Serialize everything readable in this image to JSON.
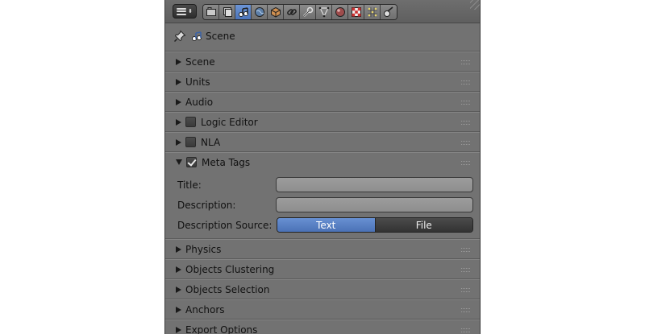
{
  "header": {
    "tabs": [
      {
        "name": "render"
      },
      {
        "name": "render-layers"
      },
      {
        "name": "scene",
        "active": true
      },
      {
        "name": "world"
      },
      {
        "name": "object"
      },
      {
        "name": "constraints"
      },
      {
        "name": "modifiers"
      },
      {
        "name": "data"
      },
      {
        "name": "material"
      },
      {
        "name": "texture"
      },
      {
        "name": "particles"
      },
      {
        "name": "physics"
      }
    ]
  },
  "context": {
    "label": "Scene"
  },
  "panels": {
    "scene": {
      "label": "Scene"
    },
    "units": {
      "label": "Units"
    },
    "audio": {
      "label": "Audio"
    },
    "logic_editor": {
      "label": "Logic Editor",
      "checked": false
    },
    "nla": {
      "label": "NLA",
      "checked": false
    },
    "meta_tags": {
      "label": "Meta Tags",
      "checked": true,
      "expanded": true,
      "title_label": "Title:",
      "title_value": "",
      "description_label": "Description:",
      "description_value": "",
      "source_label": "Description Source:",
      "source_options": [
        "Text",
        "File"
      ],
      "source_selected": "Text"
    },
    "physics": {
      "label": "Physics"
    },
    "objects_clustering": {
      "label": "Objects Clustering"
    },
    "objects_selection": {
      "label": "Objects Selection"
    },
    "anchors": {
      "label": "Anchors"
    },
    "export_options": {
      "label": "Export Options"
    }
  },
  "colors": {
    "background": "#727272",
    "active_tab": "#5680c4",
    "active_toggle": "#5a82c6"
  }
}
